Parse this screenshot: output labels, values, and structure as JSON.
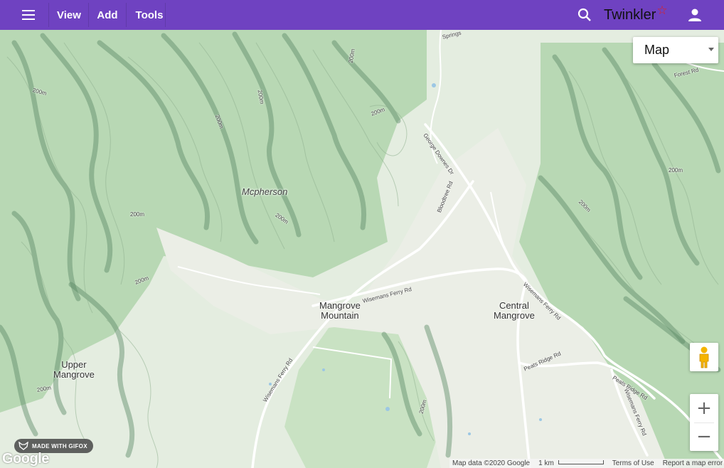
{
  "topbar": {
    "menu_icon": "hamburger-menu-icon",
    "view_label": "View",
    "add_label": "Add",
    "tools_label": "Tools",
    "search_icon": "search-icon",
    "brand_name": "Twinkler",
    "brand_star": "☆",
    "account_icon": "person-icon",
    "bar_color": "#6f42c1"
  },
  "map_controls": {
    "map_type_label": "Map",
    "pegman_icon": "pegman-icon",
    "zoom_in_label": "+",
    "zoom_out_label": "−"
  },
  "map_labels": {
    "mcpherson": "Mcpherson",
    "mangrove_mountain_1": "Mangrove",
    "mangrove_mountain_2": "Mountain",
    "central_mangrove_1": "Central",
    "central_mangrove_2": "Mangrove",
    "upper_mangrove_1": "Upper",
    "upper_mangrove_2": "Mangrove"
  },
  "road_labels": {
    "forest_rd": "Forest Rd",
    "george_downes_dr": "George Downes Dr",
    "bloodtree_rd": "Bloodtree Rd",
    "wisemans_ferry_rd_1": "Wisemans Ferry Rd",
    "wisemans_ferry_rd_2": "Wisemans Ferry Rd",
    "wisemans_ferry_rd_3": "Wisemans Ferry Rd",
    "wisemans_ferry_rd_4": "Wisemans Ferry Rd",
    "peats_ridge_rd_1": "Peats Ridge Rd",
    "peats_ridge_rd_2": "Peats Ridge Rd",
    "springs": "Springs"
  },
  "contour_labels": [
    "200m",
    "200m",
    "200m",
    "200m",
    "200m",
    "200m",
    "200m",
    "200m",
    "200m",
    "200m",
    "200m",
    "200m"
  ],
  "overlay": {
    "gifox_badge": "MADE WITH GIFOX",
    "google_logo": "Google",
    "map_data": "Map data ©2020 Google",
    "scale": "1 km",
    "terms": "Terms of Use",
    "report": "Report a map error"
  }
}
